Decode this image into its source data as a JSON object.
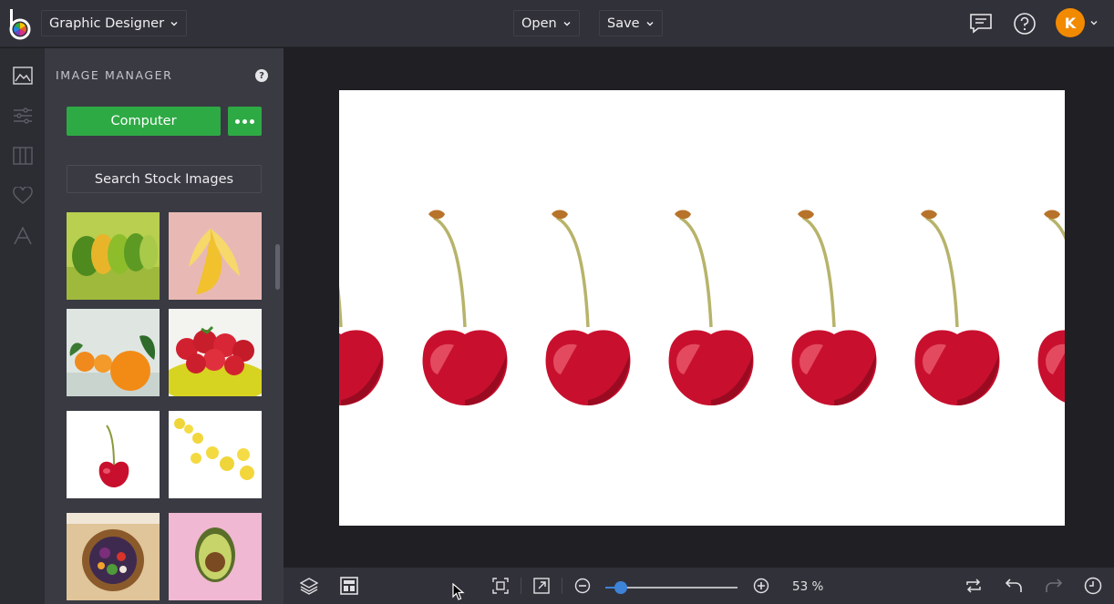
{
  "topbar": {
    "mode_label": "Graphic Designer",
    "open_label": "Open",
    "save_label": "Save",
    "avatar_initial": "K"
  },
  "rail": {
    "items": [
      "image-icon",
      "sliders-icon",
      "columns-icon",
      "heart-icon",
      "text-icon"
    ]
  },
  "panel": {
    "title": "IMAGE MANAGER",
    "help": "?",
    "computer_label": "Computer",
    "search_label": "Search Stock Images",
    "thumbnails": [
      "limes",
      "banana",
      "oranges",
      "strawberries",
      "cherry",
      "lemons",
      "salad-bowl",
      "avocado"
    ]
  },
  "zoom": {
    "percent": 53,
    "label": "53 %"
  },
  "colors": {
    "accent_green": "#2eaa45",
    "accent_blue": "#3d83d8",
    "avatar_orange": "#f28a00",
    "cherry_red": "#c8102e"
  }
}
